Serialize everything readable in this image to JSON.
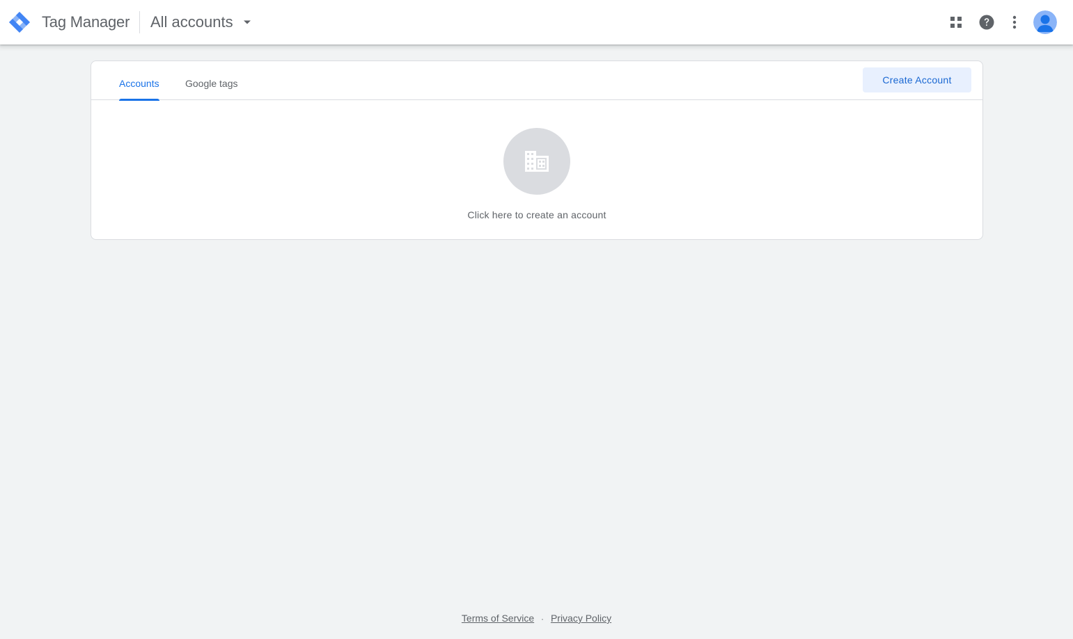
{
  "header": {
    "product_name": "Tag Manager",
    "account_switcher_label": "All accounts",
    "icons": {
      "logo": "tag-manager-logo-icon",
      "caret": "caret-down-icon",
      "apps": "apps-grid-icon",
      "help": "help-icon",
      "more": "more-vert-icon",
      "avatar": "account-avatar-icon"
    }
  },
  "tabs": [
    {
      "label": "Accounts",
      "active": true
    },
    {
      "label": "Google tags",
      "active": false
    }
  ],
  "actions": {
    "create_account_label": "Create Account"
  },
  "empty_state": {
    "text": "Click here to create an account",
    "icon": "building-icon"
  },
  "footer": {
    "terms_label": "Terms of Service",
    "separator": "·",
    "privacy_label": "Privacy Policy"
  },
  "colors": {
    "accent": "#1a73e8",
    "button_bg": "#e8f0fe",
    "page_bg": "#f1f3f4",
    "avatar": "#8ab4f8"
  }
}
